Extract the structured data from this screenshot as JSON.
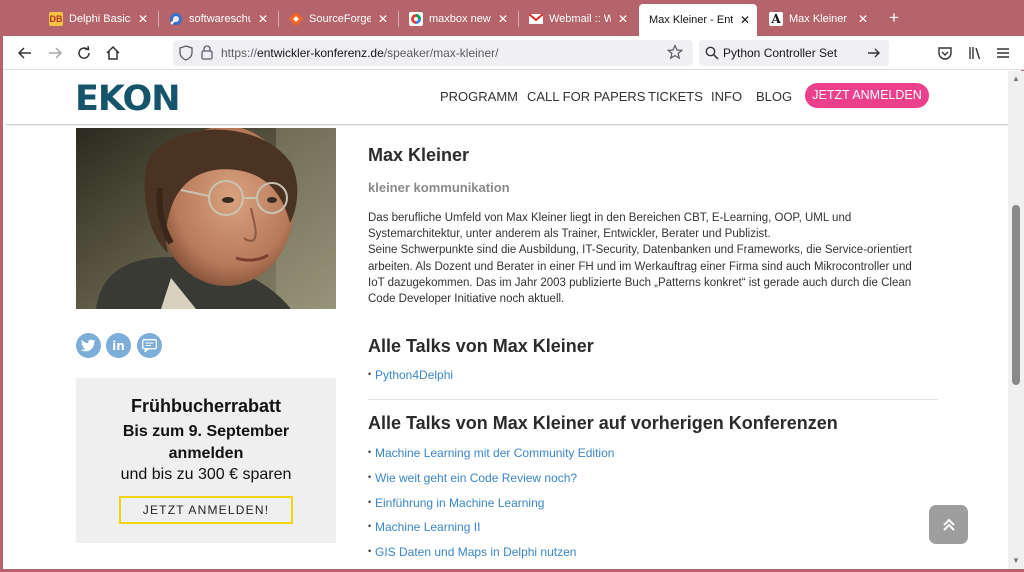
{
  "browser": {
    "tabs": [
      {
        "title": "Delphi Basics",
        "icon": "delphi-basics-favicon",
        "active": false
      },
      {
        "title": "softwareschule.ch",
        "icon": "softwareschule-favicon",
        "active": false
      },
      {
        "title": "SourceForge - Do",
        "icon": "sourceforge-favicon",
        "active": false
      },
      {
        "title": "maxbox news",
        "icon": "maxbox-favicon",
        "active": false
      },
      {
        "title": "Webmail :: Welco",
        "icon": "gmail-favicon",
        "active": false
      },
      {
        "title": "Max Kleiner - Entwick",
        "icon": "none",
        "active": true
      },
      {
        "title": "Max Kleiner | Ber",
        "icon": "letter-a-favicon",
        "active": false
      }
    ],
    "url_prefix": "https://",
    "url_host": "entwickler-konferenz.de",
    "url_path": "/speaker/max-kleiner/",
    "search_value": "Python Controller Set",
    "frame_color": "#b5646c"
  },
  "site": {
    "logo": "EKON",
    "brand_color": "#16546b",
    "nav": [
      "PROGRAMM",
      "CALL FOR PAPERS",
      "TICKETS",
      "INFO",
      "BLOG"
    ],
    "cta_label": "JETZT ANMELDEN",
    "cta_color": "#ec3f8c"
  },
  "speaker": {
    "name": "Max Kleiner",
    "company": "kleiner kommunikation",
    "bio_p1": "Das berufliche Umfeld von Max Kleiner liegt in den Bereichen CBT, E-Learning, OOP, UML und Systemarchitektur, unter anderem als Trainer, Entwickler, Berater und Publizist.",
    "bio_p2": "Seine Schwerpunkte sind die Ausbildung, IT-Security, Datenbanken und Frameworks, die Service-orientiert arbeiten. Als Dozent und Berater in einer FH und im Werkauftrag einer Firma sind auch Mikrocontroller und IoT dazugekommen. Das im Jahr 2003 publizierte Buch „Patterns konkret“ ist gerade auch durch die Clean Code Developer Initiative noch aktuell.",
    "social": [
      "twitter-icon",
      "linkedin-icon",
      "chat-icon"
    ]
  },
  "promo": {
    "title": "Frühbucherrabatt",
    "line1": "Bis zum 9. September",
    "line2": "anmelden",
    "line3": "und bis zu 300 € sparen",
    "button": "JETZT ANMELDEN!"
  },
  "talks": {
    "current_heading": "Alle Talks von Max Kleiner",
    "current": [
      "Python4Delphi"
    ],
    "previous_heading": "Alle Talks von Max Kleiner auf vorherigen Konferenzen",
    "previous": [
      "Machine Learning mit der Community Edition",
      "Wie weit geht ein Code Review noch?",
      "Einführung in Machine Learning",
      "Machine Learning II",
      "GIS Daten und Maps in Delphi nutzen"
    ],
    "link_color": "#3a86c8"
  }
}
